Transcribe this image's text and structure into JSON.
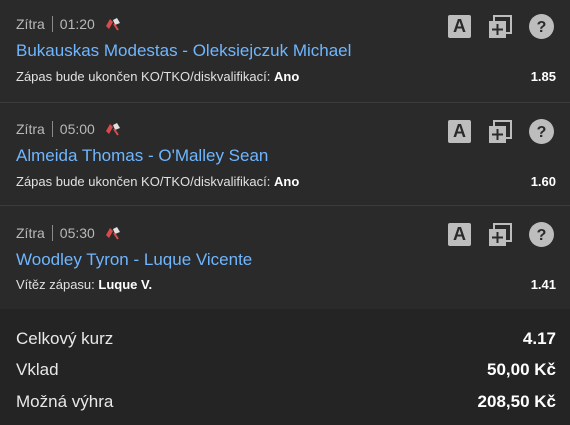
{
  "bets": [
    {
      "day": "Zítra",
      "time": "01:20",
      "match": "Bukauskas Modestas - Oleksiejczuk Michael",
      "market": "Zápas bude ukončen KO/TKO/diskvalifikací:",
      "pick": "Ano",
      "odds": "1.85",
      "sport_icon": "boxing-gloves-icon"
    },
    {
      "day": "Zítra",
      "time": "05:00",
      "match": "Almeida Thomas - O'Malley Sean",
      "market": "Zápas bude ukončen KO/TKO/diskvalifikací:",
      "pick": "Ano",
      "odds": "1.60",
      "sport_icon": "boxing-gloves-icon"
    },
    {
      "day": "Zítra",
      "time": "05:30",
      "match": "Woodley Tyron - Luque Vicente",
      "market": "Vítěz zápasu:",
      "pick": "Luque V.",
      "odds": "1.41",
      "sport_icon": "boxing-gloves-icon"
    }
  ],
  "icon_labels": {
    "a_button": "A"
  },
  "summary": {
    "total_odds_label": "Celkový kurz",
    "total_odds_value": "4.17",
    "stake_label": "Vklad",
    "stake_value": "50,00 Kč",
    "payout_label": "Možná výhra",
    "payout_value": "208,50 Kč"
  },
  "colors": {
    "background": "#2a2a2a",
    "link": "#6fb6ff",
    "icon": "#bdbdbd"
  }
}
